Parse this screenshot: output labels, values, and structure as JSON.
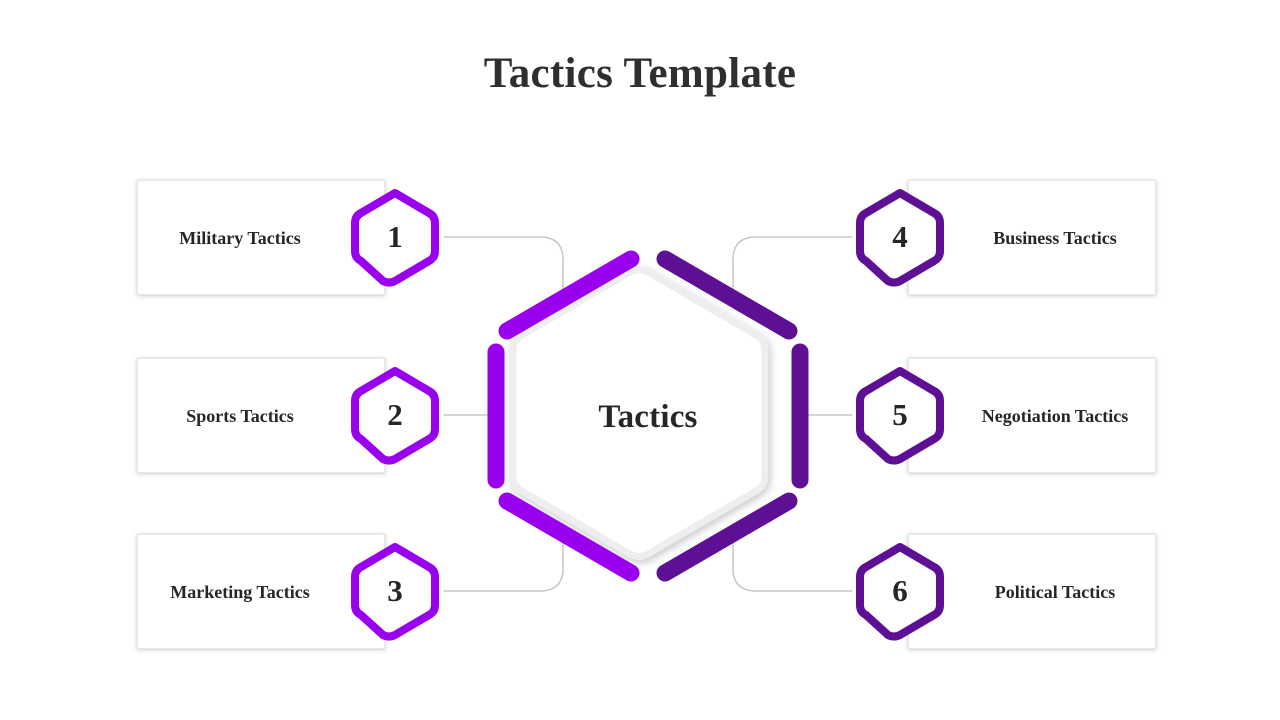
{
  "slide": {
    "title": "Tactics Template",
    "background_color": "#ffffff",
    "title_color": "#2f2f2f"
  },
  "center": {
    "label": "Tactics",
    "shape": "hexagon-outline",
    "fill_color": "#ffffff",
    "outline_color": "#f0f0f0",
    "text_color": "#262626"
  },
  "colors": {
    "accent_bright_purple": "#9900ee",
    "accent_dark_purple": "#5e1095",
    "card_border": "#e9e9e9",
    "connector_line": "#c9c9c9",
    "text_dark": "#262626"
  },
  "items": [
    {
      "number": "1",
      "label": "Military Tactics",
      "side": "left",
      "badge_color": "#9900ee",
      "segment_color": "#9900ee",
      "badge_icon": "hexagon-badge-icon"
    },
    {
      "number": "2",
      "label": "Sports Tactics",
      "side": "left",
      "badge_color": "#9900ee",
      "segment_color": "#9900ee",
      "badge_icon": "hexagon-badge-icon"
    },
    {
      "number": "3",
      "label": "Marketing Tactics",
      "side": "left",
      "badge_color": "#9900ee",
      "segment_color": "#9900ee",
      "badge_icon": "hexagon-badge-icon"
    },
    {
      "number": "4",
      "label": "Business Tactics",
      "side": "right",
      "badge_color": "#5e1095",
      "segment_color": "#5e1095",
      "badge_icon": "hexagon-badge-icon"
    },
    {
      "number": "5",
      "label": "Negotiation Tactics",
      "side": "right",
      "badge_color": "#5e1095",
      "segment_color": "#5e1095",
      "badge_icon": "hexagon-badge-icon"
    },
    {
      "number": "6",
      "label": "Political Tactics",
      "side": "right",
      "badge_color": "#5e1095",
      "segment_color": "#5e1095",
      "badge_icon": "hexagon-badge-icon"
    }
  ]
}
